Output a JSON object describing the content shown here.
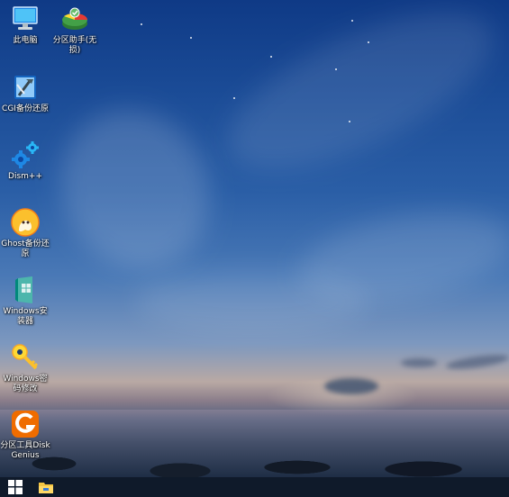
{
  "desktop": {
    "icons": [
      {
        "label": "此电脑",
        "icon": "computer-icon"
      },
      {
        "label": "分区助手(无损)",
        "icon": "partition-assistant-icon"
      },
      {
        "label": "CGI备份还原",
        "icon": "cgi-backup-icon"
      },
      {
        "label": "Dism++",
        "icon": "gears-icon"
      },
      {
        "label": "Ghost备份还原",
        "icon": "ghost-icon"
      },
      {
        "label": "Windows安装器",
        "icon": "windows-installer-icon"
      },
      {
        "label": "Windows密码修改",
        "icon": "key-icon"
      },
      {
        "label": "分区工具DiskGenius",
        "icon": "diskgenius-icon"
      }
    ]
  },
  "taskbar": {
    "items": [
      {
        "icon": "windows-start-icon"
      },
      {
        "icon": "file-explorer-icon"
      }
    ]
  },
  "colors": {
    "taskbar_bg": "#0f1a2a",
    "start_blue": "#ffffff",
    "explorer_yellow": "#f4c542"
  }
}
